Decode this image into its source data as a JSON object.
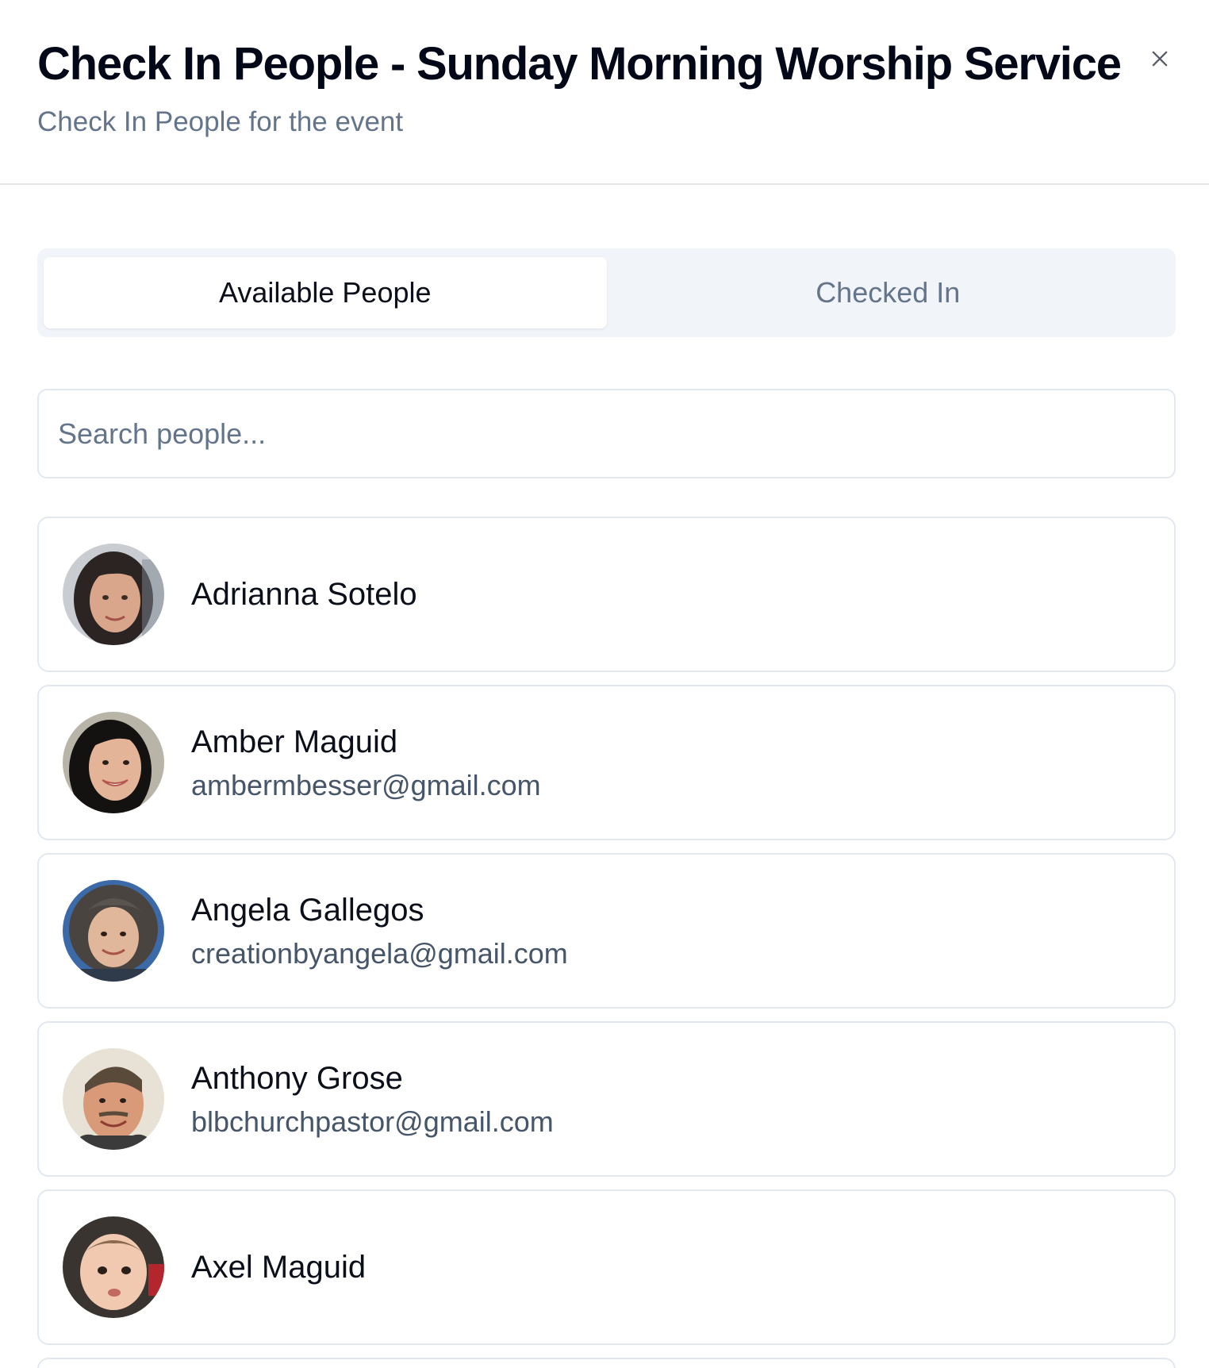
{
  "dialog": {
    "title": "Check In People - Sunday Morning Worship Service",
    "subtitle": "Check In People for the event",
    "close_icon": "close-icon"
  },
  "tabs": [
    {
      "label": "Available People",
      "active": true
    },
    {
      "label": "Checked In",
      "active": false
    }
  ],
  "search": {
    "placeholder": "Search people...",
    "value": ""
  },
  "people": [
    {
      "name": "Adrianna Sotelo",
      "email": ""
    },
    {
      "name": "Amber Maguid",
      "email": "ambermbesser@gmail.com"
    },
    {
      "name": "Angela Gallegos",
      "email": "creationbyangela@gmail.com"
    },
    {
      "name": "Anthony Grose",
      "email": "blbchurchpastor@gmail.com"
    },
    {
      "name": "Axel Maguid",
      "email": ""
    }
  ],
  "colors": {
    "title": "#020817",
    "muted": "#64748b",
    "border": "#e2e8f0",
    "tab_bg": "#f1f5f9"
  }
}
